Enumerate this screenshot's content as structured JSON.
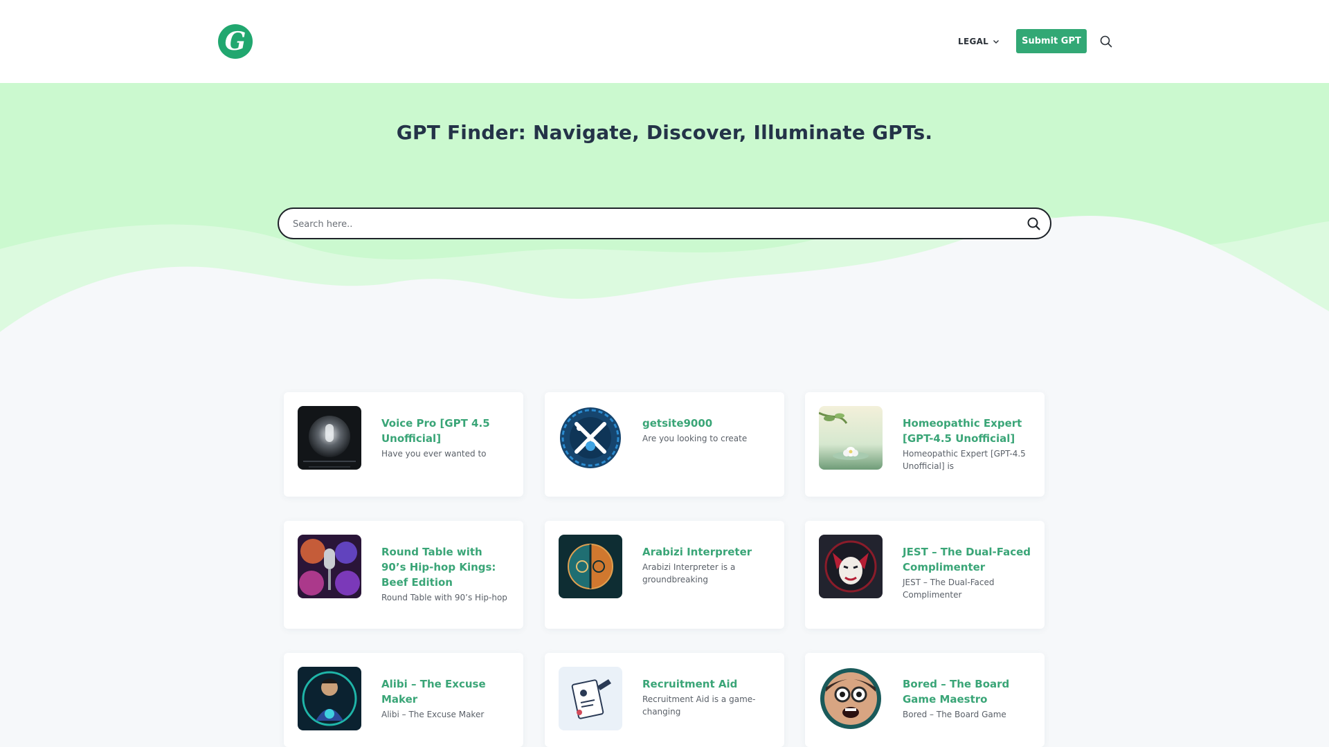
{
  "header": {
    "logo_letter": "G",
    "legal_label": "LEGAL",
    "submit_label": "Submit GPT"
  },
  "hero": {
    "title": "GPT Finder: Navigate, Discover, Illuminate GPTs.",
    "search_placeholder": "Search here.."
  },
  "colors": {
    "brand_green": "#32a875",
    "hero_bg": "#cbf9cf",
    "title_color": "#243348",
    "card_title": "#3aa577"
  },
  "cards": [
    {
      "title": "Voice Pro [GPT 4.5 Unofficial]",
      "desc": "Have you ever wanted to",
      "icon": "microphone-orb-icon"
    },
    {
      "title": "getsite9000",
      "desc": "Are you looking to create",
      "icon": "wrench-gear-icon"
    },
    {
      "title": "Homeopathic Expert [GPT-4.5 Unofficial]",
      "desc": "Homeopathic Expert [GPT-4.5 Unofficial] is",
      "icon": "flower-landscape-icon"
    },
    {
      "title": "Round Table with 90’s Hip-hop Kings: Beef Edition",
      "desc": "Round Table with 90’s Hip-hop",
      "icon": "hiphop-microphone-icon"
    },
    {
      "title": "Arabizi Interpreter",
      "desc": "Arabizi Interpreter is a groundbreaking",
      "icon": "arabizi-emblem-icon"
    },
    {
      "title": "JEST – The Dual-Faced Complimenter",
      "desc": "JEST – The Dual-Faced Complimenter",
      "icon": "jester-mask-icon"
    },
    {
      "title": "Alibi – The Excuse Maker",
      "desc": "Alibi – The Excuse Maker",
      "icon": "alibi-character-icon"
    },
    {
      "title": "Recruitment Aid",
      "desc": "Recruitment Aid is a game-changing",
      "icon": "clipboard-pen-icon"
    },
    {
      "title": "Bored – The Board Game Maestro",
      "desc": "Bored – The Board Game",
      "icon": "goggles-character-icon"
    }
  ]
}
